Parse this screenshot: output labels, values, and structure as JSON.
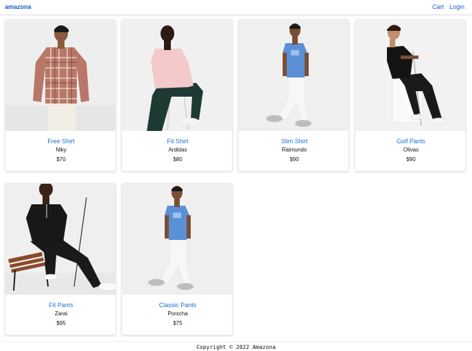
{
  "header": {
    "brand": "amazona",
    "nav": {
      "cart": "Cart",
      "login": "Login"
    }
  },
  "products": [
    {
      "name": "Free Shirt",
      "brand": "Niky",
      "price": "$70",
      "image": "man-plaid-shirt-photo"
    },
    {
      "name": "Fit Shirt",
      "brand": "Ardidas",
      "price": "$80",
      "image": "man-pink-shirt-seated-photo"
    },
    {
      "name": "Slim Shirt",
      "brand": "Raimundo",
      "price": "$90",
      "image": "man-blue-tshirt-walking-photo"
    },
    {
      "name": "Golf Pants",
      "brand": "Olivas",
      "price": "$90",
      "image": "man-black-polo-golf-club-photo"
    },
    {
      "name": "Fit Pants",
      "brand": "Zarai",
      "price": "$95",
      "image": "man-black-polo-bench-photo"
    },
    {
      "name": "Classic Pants",
      "brand": "Porscha",
      "price": "$75",
      "image": "man-blue-tshirt-walking-photo"
    }
  ],
  "footer": {
    "text": "Copyright © 2022 Amazona"
  },
  "colors": {
    "link": "#1a6fd0",
    "brand": "#1a5fc6",
    "photo_bg": "#efefef"
  }
}
